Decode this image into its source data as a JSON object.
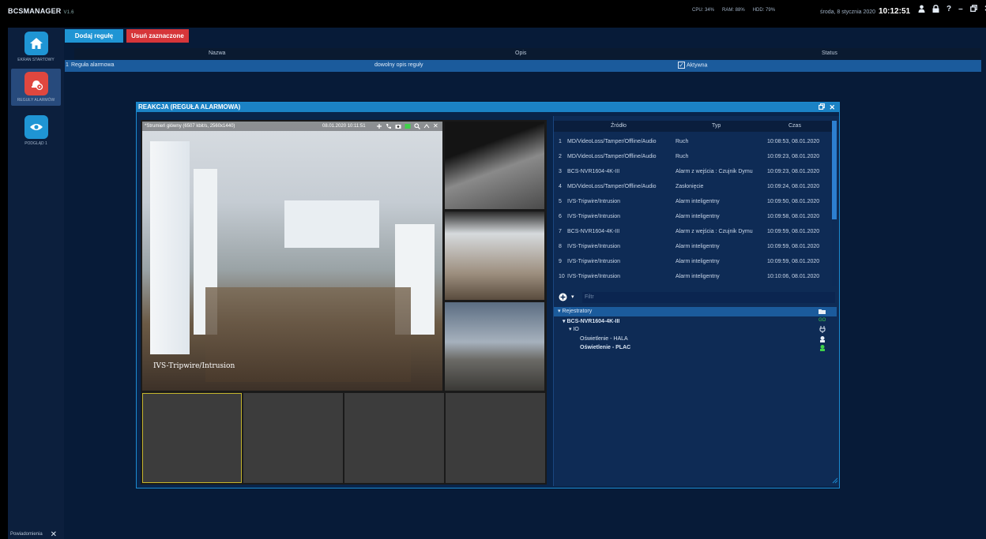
{
  "app": {
    "brand": "BCSMANAGER",
    "version": "V1.6",
    "cpu": "CPU: 34%",
    "ram": "RAM: 88%",
    "hdd": "HDD: 79%",
    "date": "środa, 8 stycznia 2020",
    "time": "10:12:51"
  },
  "sidebar": {
    "items": [
      {
        "label": "EKRAN STARTOWY",
        "icon": "home-icon"
      },
      {
        "label": "REGUŁY ALARMÓW",
        "icon": "alarm-rules-icon"
      },
      {
        "label": "PODGLĄD 1",
        "icon": "eye-icon"
      }
    ],
    "notifications": "Powiadomienia"
  },
  "toolbar": {
    "add_label": "Dodaj regułę",
    "delete_label": "Usuń zaznaczone"
  },
  "rules_table": {
    "columns": [
      "Nazwa",
      "Opis",
      "Status"
    ],
    "rows": [
      {
        "index": "1",
        "name": "Reguła alarmowa",
        "description": "dowolny opis reguły",
        "status": "Aktywna"
      }
    ]
  },
  "dialog": {
    "title": "REAKCJA (REGUŁA ALARMOWA)",
    "main_stream_label": "*Strumień główny (6507 kbit/s, 2560x1440)",
    "main_cam_timestamp": "08.01.2020 10:11:51",
    "main_cam_overlay": "IVS-Tripwire/Intrusion",
    "events": {
      "columns": [
        "Źródło",
        "Typ",
        "Czas"
      ],
      "rows": [
        {
          "n": "1",
          "source": "MD/VideoLoss/Tamper/Offline/Audio",
          "type": "Ruch",
          "time": "10:08:53, 08.01.2020"
        },
        {
          "n": "2",
          "source": "MD/VideoLoss/Tamper/Offline/Audio",
          "type": "Ruch",
          "time": "10:09:23, 08.01.2020"
        },
        {
          "n": "3",
          "source": "BCS-NVR1604-4K-III",
          "type": "Alarm z wejścia : Czujnik Dymu",
          "time": "10:09:23, 08.01.2020"
        },
        {
          "n": "4",
          "source": "MD/VideoLoss/Tamper/Offline/Audio",
          "type": "Zasłonięcie",
          "time": "10:09:24, 08.01.2020"
        },
        {
          "n": "5",
          "source": "IVS-Tripwire/Intrusion",
          "type": "Alarm inteligentny",
          "time": "10:09:50, 08.01.2020"
        },
        {
          "n": "6",
          "source": "IVS-Tripwire/Intrusion",
          "type": "Alarm inteligentny",
          "time": "10:09:58, 08.01.2020"
        },
        {
          "n": "7",
          "source": "BCS-NVR1604-4K-III",
          "type": "Alarm z wejścia : Czujnik Dymu",
          "time": "10:09:59, 08.01.2020"
        },
        {
          "n": "8",
          "source": "IVS-Tripwire/Intrusion",
          "type": "Alarm inteligentny",
          "time": "10:09:59, 08.01.2020"
        },
        {
          "n": "9",
          "source": "IVS-Tripwire/Intrusion",
          "type": "Alarm inteligentny",
          "time": "10:09:59, 08.01.2020"
        },
        {
          "n": "10",
          "source": "IVS-Tripwire/Intrusion",
          "type": "Alarm inteligentny",
          "time": "10:10:06, 08.01.2020"
        }
      ]
    },
    "filter_placeholder": "Filtr",
    "tree": {
      "root": "Rejestratory",
      "device": "BCS-NVR1604-4K-III",
      "group": "IO",
      "outputs": [
        "Oświetlenie - HALA",
        "Oświetlenie - PLAC"
      ]
    }
  },
  "colors": {
    "accent": "#1f95d4",
    "danger": "#d6363a",
    "selected_row": "#1b5b9c",
    "background": "#071b38"
  }
}
